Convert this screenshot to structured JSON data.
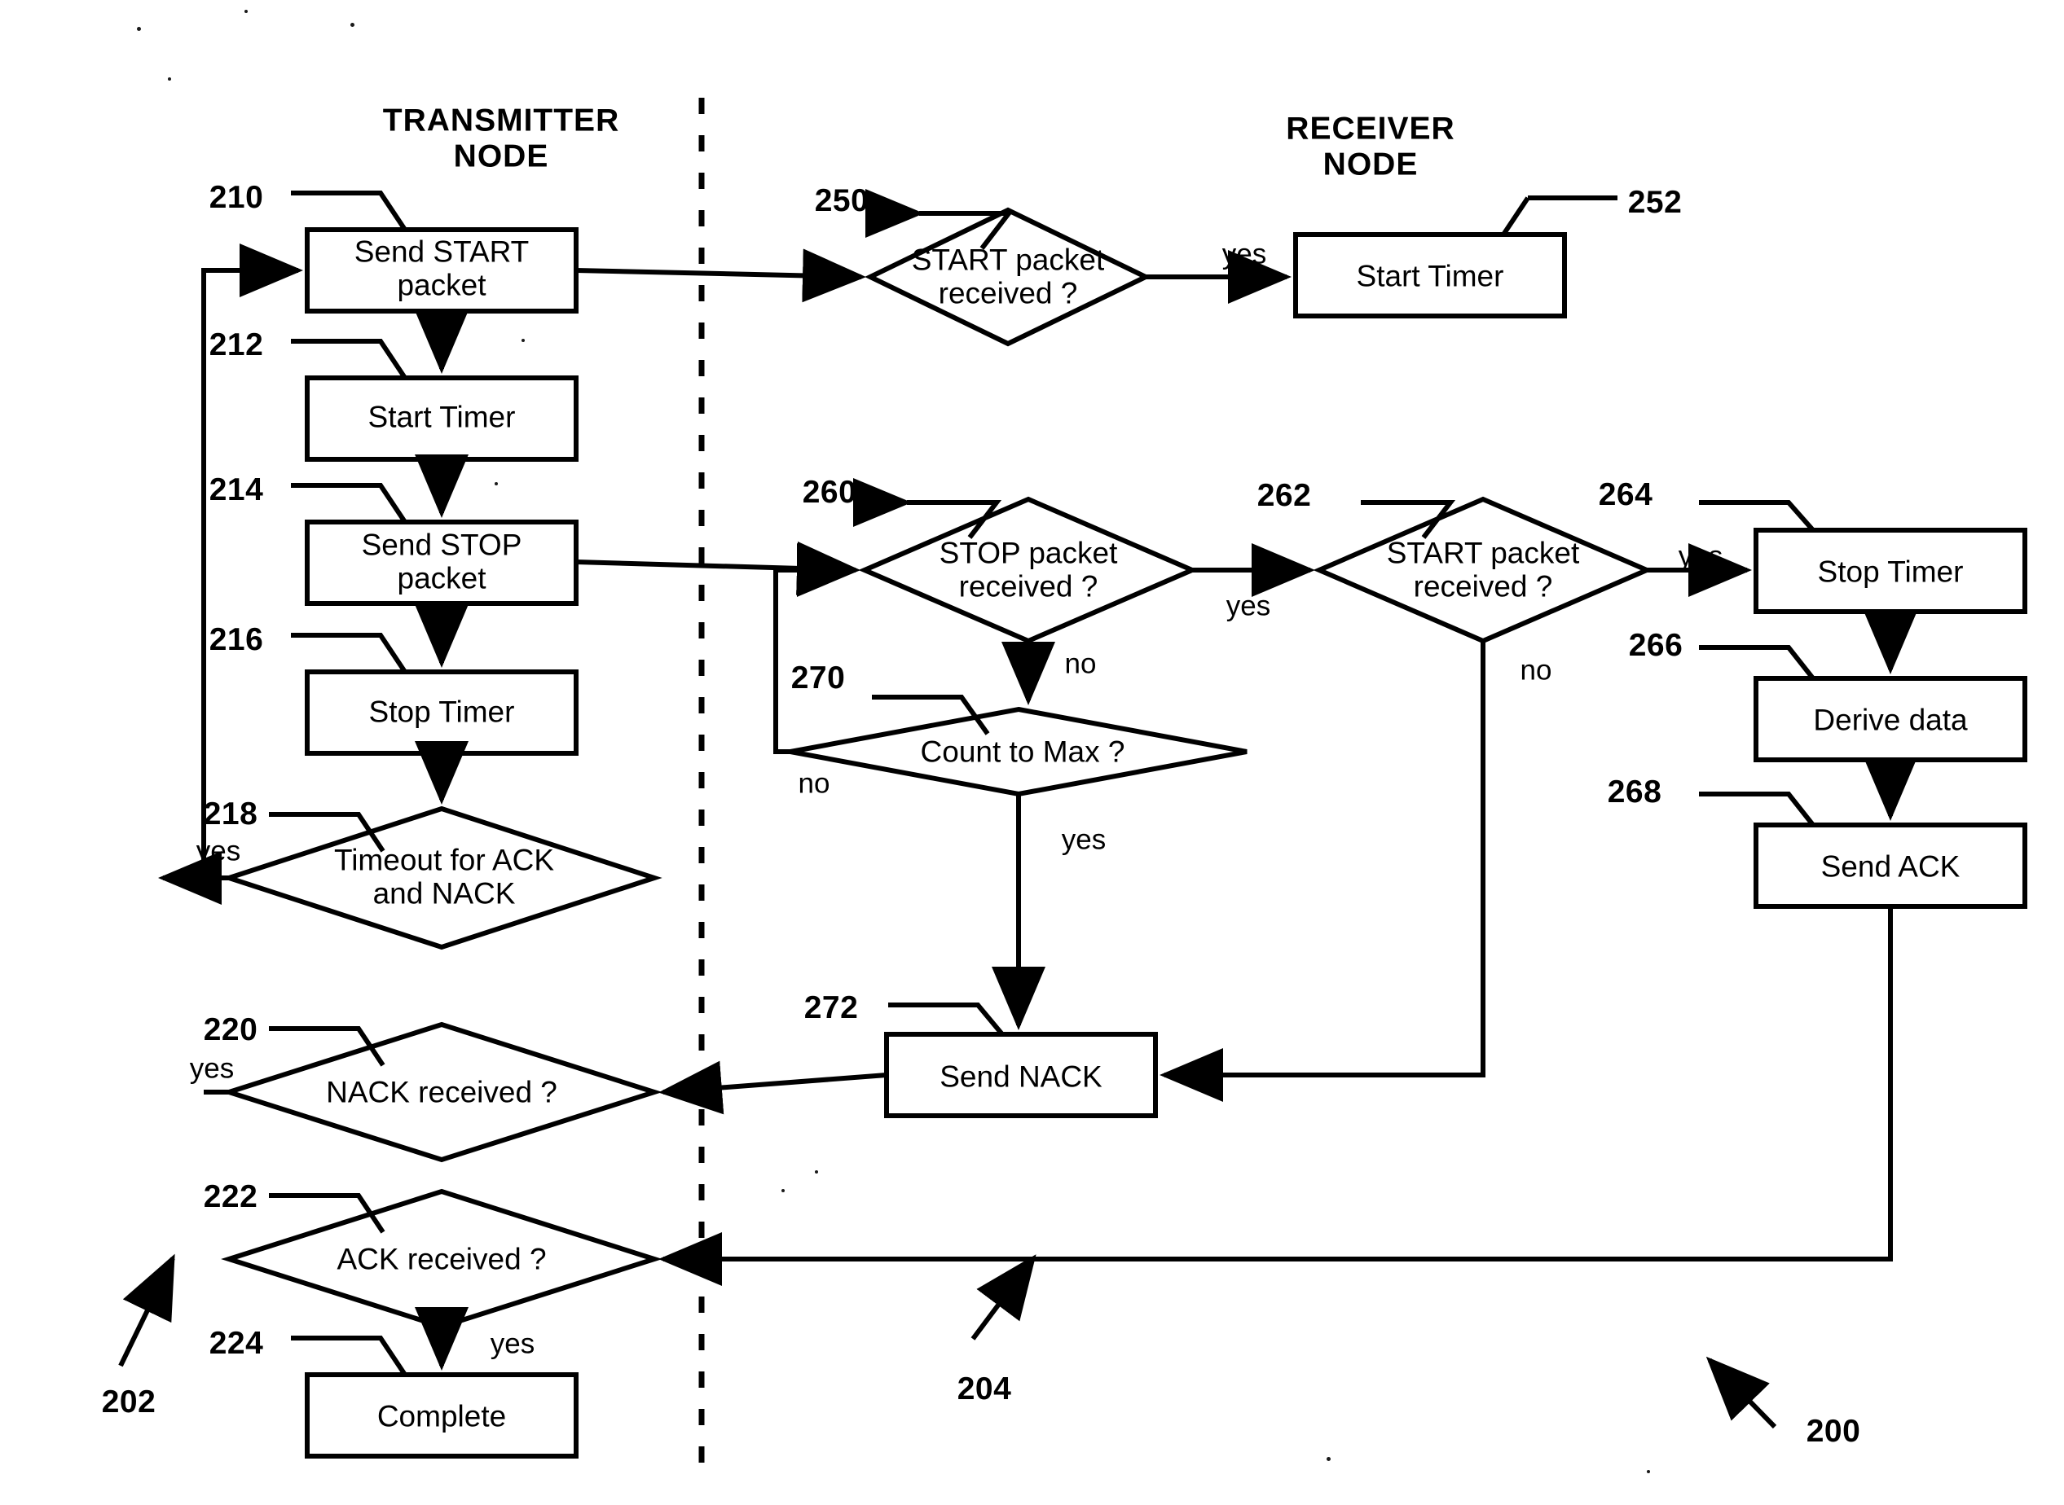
{
  "figure": {
    "columns": [
      {
        "id": "transmitter",
        "label": "TRANSMITTER\nNODE"
      },
      {
        "id": "receiver",
        "label": "RECEIVER\nNODE"
      }
    ],
    "reference_numerals": {
      "figure": "200",
      "transmitter_process": "202",
      "receiver_process": "204"
    },
    "nodes": [
      {
        "ref": "210",
        "label": "Send START\npacket",
        "shape": "rect",
        "column": "transmitter"
      },
      {
        "ref": "212",
        "label": "Start Timer",
        "shape": "rect",
        "column": "transmitter"
      },
      {
        "ref": "214",
        "label": "Send STOP\npacket",
        "shape": "rect",
        "column": "transmitter"
      },
      {
        "ref": "216",
        "label": "Stop Timer",
        "shape": "rect",
        "column": "transmitter"
      },
      {
        "ref": "218",
        "label": "Timeout for ACK\nand NACK",
        "shape": "diamond",
        "column": "transmitter"
      },
      {
        "ref": "220",
        "label": "NACK received ?",
        "shape": "diamond",
        "column": "transmitter"
      },
      {
        "ref": "222",
        "label": "ACK received ?",
        "shape": "diamond",
        "column": "transmitter"
      },
      {
        "ref": "224",
        "label": "Complete",
        "shape": "rect",
        "column": "transmitter"
      },
      {
        "ref": "250",
        "label": "START packet\nreceived ?",
        "shape": "diamond",
        "column": "receiver"
      },
      {
        "ref": "252",
        "label": "Start Timer",
        "shape": "rect",
        "column": "receiver"
      },
      {
        "ref": "260",
        "label": "STOP packet\nreceived ?",
        "shape": "diamond",
        "column": "receiver"
      },
      {
        "ref": "262",
        "label": "START packet\nreceived ?",
        "shape": "diamond",
        "column": "receiver"
      },
      {
        "ref": "264",
        "label": "Stop Timer",
        "shape": "rect",
        "column": "receiver"
      },
      {
        "ref": "266",
        "label": "Derive data",
        "shape": "rect",
        "column": "receiver"
      },
      {
        "ref": "268",
        "label": "Send ACK",
        "shape": "rect",
        "column": "receiver"
      },
      {
        "ref": "270",
        "label": "Count to Max ?",
        "shape": "diamond",
        "column": "receiver"
      },
      {
        "ref": "272",
        "label": "Send NACK",
        "shape": "rect",
        "column": "receiver"
      }
    ],
    "branch_labels": {
      "start_packet_yes": "yes",
      "timeout_yes": "yes",
      "nack_yes": "yes",
      "ack_yes": "yes",
      "stop_packet_yes": "yes",
      "stop_packet_no": "no",
      "start_packet2_yes": "yes",
      "start_packet2_no": "no",
      "count_max_no": "no",
      "count_max_yes": "yes"
    },
    "colors": {
      "stroke": "#000000",
      "background": "#ffffff"
    }
  }
}
